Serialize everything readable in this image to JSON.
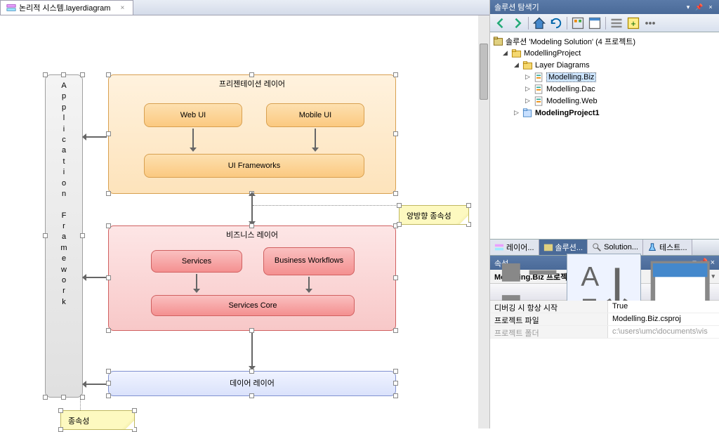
{
  "tab": {
    "title": "논리적 시스템.layerdiagram"
  },
  "diagram": {
    "appFramework": "Application Framework",
    "presentation": {
      "title": "프리젠테이션 레이어",
      "webui": "Web UI",
      "mobileui": "Mobile UI",
      "frameworks": "UI Frameworks"
    },
    "business": {
      "title": "비즈니스 레이어",
      "services": "Services",
      "workflows": "Business Workflows",
      "core": "Services Core"
    },
    "data": {
      "title": "데이어 레이어"
    },
    "notes": {
      "bidir": "양방향 종속성",
      "dep": "종속성"
    }
  },
  "solutionExplorer": {
    "title": "솔루션 탐색기",
    "root": "솔루션 'Modeling Solution' (4 프로젝트)",
    "nodes": {
      "modellingProject": "ModellingProject",
      "layerDiagrams": "Layer Diagrams",
      "biz": "Modelling.Biz",
      "dac": "Modelling.Dac",
      "web": "Modelling.Web",
      "project1": "ModelingProject1"
    }
  },
  "toolTabs": {
    "t1": "레이어...",
    "t2": "솔루션...",
    "t3": "Solution...",
    "t4": "테스트..."
  },
  "properties": {
    "header": "속성",
    "sub": "Modelling.Biz 프로젝트 속성",
    "rows": [
      {
        "k": "디버깅 시 항상 시작",
        "v": "True"
      },
      {
        "k": "프로젝트 파일",
        "v": "Modelling.Biz.csproj"
      },
      {
        "k": "프로젝트 폴더",
        "v": "c:\\users\\umc\\documents\\vis"
      }
    ]
  },
  "colors": {
    "orangeBorder": "#d8a050",
    "orangeFill": "#fde3bb",
    "orangeInner": "#fcc88a",
    "redBorder": "#d06060",
    "redFill": "#fbd0d0",
    "redInner": "#f6a0a0",
    "blueBorder": "#8090d0",
    "blueFill": "#e2e8fb",
    "grayBorder": "#a0a0a0",
    "grayFill": "#e8e8e8"
  }
}
